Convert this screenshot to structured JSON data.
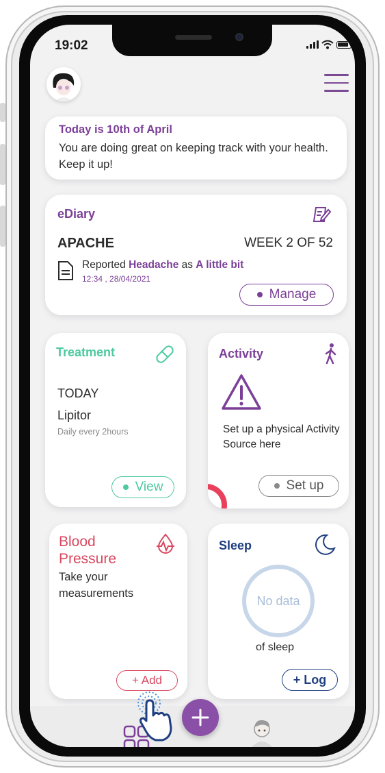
{
  "status_bar": {
    "time": "19:02"
  },
  "greeting": {
    "date_line": "Today is 10th of April",
    "message": "You are doing great on keeping track with your health. Keep it up!"
  },
  "ediary": {
    "title": "eDiary",
    "name": "APACHE",
    "week": "WEEK 2 OF 52",
    "report_prefix": "Reported ",
    "symptom": "Headache",
    "report_mid": " as ",
    "severity": "A little bit",
    "timestamp": "12:34 , 28/04/2021",
    "manage_label": "Manage"
  },
  "treatment": {
    "title": "Treatment",
    "day": "TODAY",
    "drug": "Lipitor",
    "schedule": "Daily every 2hours",
    "view_label": "View"
  },
  "activity": {
    "title": "Activity",
    "message": "Set up a physical Activity Source here",
    "setup_label": "Set up"
  },
  "blood_pressure": {
    "title_line1": "Blood",
    "title_line2": "Pressure",
    "message": "Take your measurements",
    "add_label": "+ Add"
  },
  "sleep": {
    "title": "Sleep",
    "ring_text": "No data",
    "caption": "of sleep",
    "log_label": "+ Log"
  },
  "colors": {
    "purple": "#7b3f98",
    "green": "#4ec9a0",
    "red": "#d9485f",
    "navy": "#1f3f80",
    "ring": "#c8d6ea"
  },
  "icons": [
    "avatar",
    "menu-icon",
    "notepad-icon",
    "document-icon",
    "pill-icon",
    "walking-icon",
    "warning-icon",
    "blood-drop-icon",
    "moon-icon",
    "grid-icon",
    "plus-icon",
    "profile-icon",
    "tap-hand-icon"
  ]
}
